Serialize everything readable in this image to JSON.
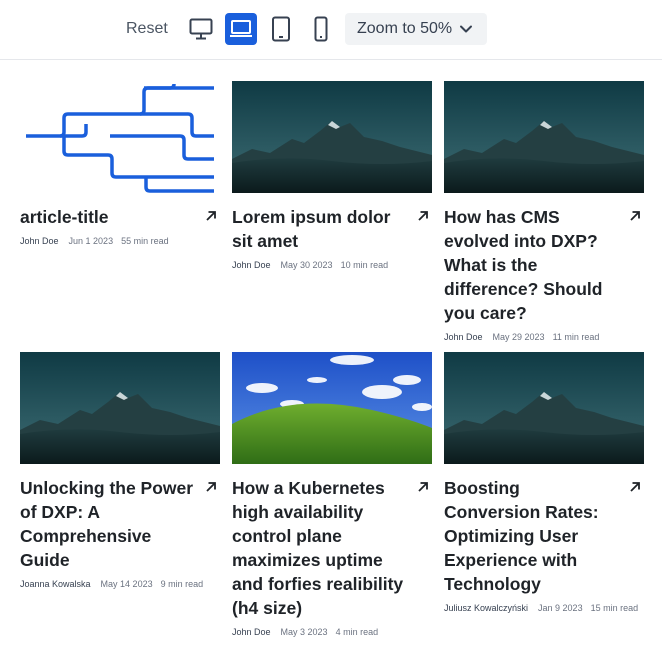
{
  "toolbar": {
    "reset_label": "Reset",
    "devices": [
      {
        "name": "desktop",
        "active": false
      },
      {
        "name": "laptop",
        "active": true
      },
      {
        "name": "tablet",
        "active": false
      },
      {
        "name": "mobile",
        "active": false
      }
    ],
    "zoom_label": "Zoom to 50%"
  },
  "colors": {
    "accent": "#1a5fdc",
    "text": "#1f2328",
    "muted": "#6b7280"
  },
  "articles": [
    {
      "title": "article-title",
      "author": "John Doe",
      "date": "Jun 1 2023",
      "read_time": "55 min read",
      "image": "lines-pattern"
    },
    {
      "title": "Lorem ipsum dolor sit amet",
      "author": "John Doe",
      "date": "May 30 2023",
      "read_time": "10 min read",
      "image": "mountain"
    },
    {
      "title": "How has CMS evolved into DXP? What is the difference? Should you care?",
      "author": "John Doe",
      "date": "May 29 2023",
      "read_time": "11 min read",
      "image": "mountain"
    },
    {
      "title": "Unlocking the Power of DXP: A Comprehensive Guide",
      "author": "Joanna Kowalska",
      "date": "May 14 2023",
      "read_time": "9 min read",
      "image": "mountain"
    },
    {
      "title": "How a Kubernetes high availability control plane maximizes uptime and forfies realibility (h4 size)",
      "author": "John Doe",
      "date": "May 3 2023",
      "read_time": "4 min read",
      "image": "green-hill"
    },
    {
      "title": "Boosting Conversion Rates: Optimizing User Experience with Technology",
      "author": "Juliusz Kowalczyński",
      "date": "Jan 9 2023",
      "read_time": "15 min read",
      "image": "mountain"
    }
  ]
}
